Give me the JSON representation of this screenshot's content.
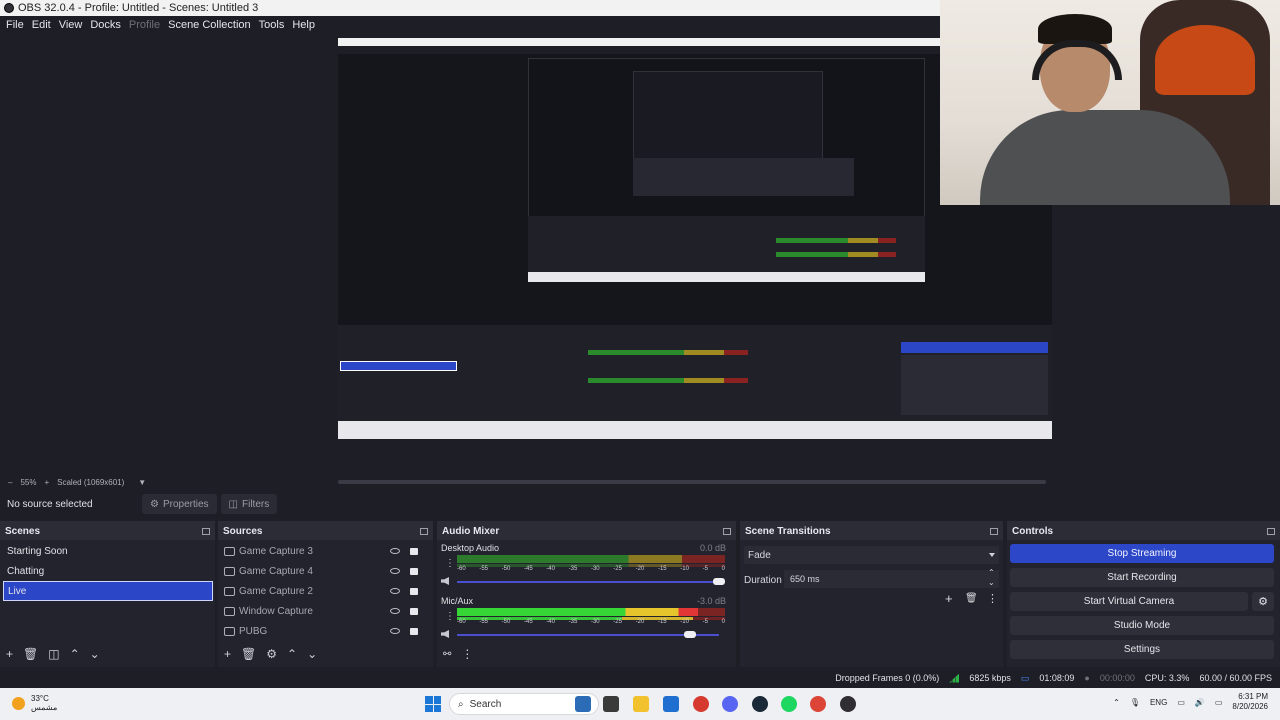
{
  "window": {
    "title": "OBS 32.0.4 - Profile: Untitled - Scenes: Untitled 3"
  },
  "menu": {
    "items": [
      "File",
      "Edit",
      "View",
      "Docks",
      "Profile",
      "Scene Collection",
      "Tools",
      "Help"
    ]
  },
  "zoom": {
    "minus": "–",
    "level": "55%",
    "plus": "+",
    "scale_label": "Scaled (1069x601)"
  },
  "properties_bar": {
    "no_source": "No source selected",
    "properties": "Properties",
    "filters": "Filters"
  },
  "scenes": {
    "title": "Scenes",
    "items": [
      "Starting Soon",
      "Chatting",
      "Live"
    ],
    "selected": "Live"
  },
  "sources": {
    "title": "Sources",
    "items": [
      "Game Capture 3",
      "Game Capture 4",
      "Game Capture 2",
      "Window Capture",
      "PUBG"
    ]
  },
  "audio_mixer": {
    "title": "Audio Mixer",
    "channels": [
      {
        "name": "Desktop Audio",
        "db": "0.0 dB",
        "level": 0.0
      },
      {
        "name": "Mic/Aux",
        "db": "-3.0 dB",
        "level": 0.86
      }
    ],
    "scale": [
      "-60",
      "-55",
      "-50",
      "-45",
      "-40",
      "-35",
      "-30",
      "-25",
      "-20",
      "-15",
      "-10",
      "-5",
      "0"
    ]
  },
  "transitions": {
    "title": "Scene Transitions",
    "selected": "Fade",
    "duration_label": "Duration",
    "duration": "650 ms"
  },
  "controls": {
    "title": "Controls",
    "stop_streaming": "Stop Streaming",
    "start_recording": "Start Recording",
    "start_virtual_camera": "Start Virtual Camera",
    "studio_mode": "Studio Mode",
    "settings": "Settings"
  },
  "status": {
    "dropped_frames": "Dropped Frames 0 (0.0%)",
    "bitrate": "6825 kbps",
    "stream_time": "01:08:09",
    "record_time": "00:00:00",
    "cpu": "CPU: 3.3%",
    "fps": "60.00 / 60.00 FPS"
  },
  "taskbar": {
    "temp": "33°C",
    "weather": "مشمس",
    "search": "Search",
    "lang": "ENG",
    "time": "6:31 PM",
    "date": "8/20/2026"
  },
  "colors": {
    "accent": "#2c47c8",
    "bg": "#1e1f26",
    "dock": "#22232c"
  }
}
